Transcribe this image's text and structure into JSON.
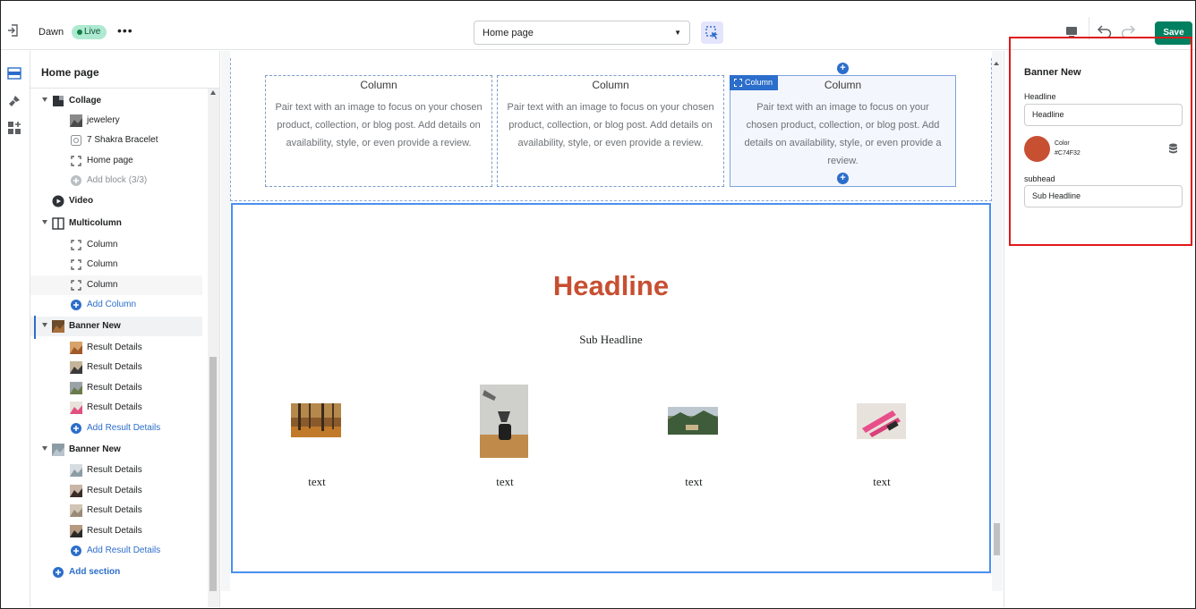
{
  "topbar": {
    "theme_name": "Dawn",
    "status_badge": "Live",
    "more_label": "•••",
    "template_select": "Home page",
    "save_label": "Save"
  },
  "sidebar": {
    "title": "Home page",
    "rows": [
      {
        "kind": "section",
        "label": "Collage",
        "icon": "collage-icon"
      },
      {
        "kind": "block",
        "label": "jewelery",
        "icon": "image-thumb"
      },
      {
        "kind": "block",
        "label": "7 Shakra Bracelet",
        "icon": "product-icon"
      },
      {
        "kind": "block",
        "label": "Home page",
        "icon": "block-frame-icon"
      },
      {
        "kind": "add-muted",
        "label": "Add block (3/3)",
        "icon": "plus-circle-icon"
      },
      {
        "kind": "section",
        "label": "Video",
        "icon": "play-icon"
      },
      {
        "kind": "section",
        "label": "Multicolumn",
        "icon": "columns-icon"
      },
      {
        "kind": "block",
        "label": "Column",
        "icon": "block-frame-icon"
      },
      {
        "kind": "block",
        "label": "Column",
        "icon": "block-frame-icon"
      },
      {
        "kind": "block",
        "label": "Column",
        "icon": "block-frame-icon"
      },
      {
        "kind": "add",
        "label": "Add Column",
        "icon": "plus-circle-icon"
      },
      {
        "kind": "section",
        "label": "Banner New",
        "icon": "image-thumb"
      },
      {
        "kind": "block",
        "label": "Result Details",
        "icon": "image-thumb"
      },
      {
        "kind": "block",
        "label": "Result Details",
        "icon": "image-thumb"
      },
      {
        "kind": "block",
        "label": "Result Details",
        "icon": "image-thumb"
      },
      {
        "kind": "block",
        "label": "Result Details",
        "icon": "image-thumb"
      },
      {
        "kind": "add",
        "label": "Add Result Details",
        "icon": "plus-circle-icon"
      },
      {
        "kind": "section",
        "label": "Banner New",
        "icon": "image-thumb"
      },
      {
        "kind": "block",
        "label": "Result Details",
        "icon": "image-thumb"
      },
      {
        "kind": "block",
        "label": "Result Details",
        "icon": "image-thumb"
      },
      {
        "kind": "block",
        "label": "Result Details",
        "icon": "image-thumb"
      },
      {
        "kind": "block",
        "label": "Result Details",
        "icon": "image-thumb"
      },
      {
        "kind": "add",
        "label": "Add Result Details",
        "icon": "plus-circle-icon"
      },
      {
        "kind": "add-section",
        "label": "Add section",
        "icon": "plus-circle-icon"
      }
    ]
  },
  "preview": {
    "columns": [
      {
        "title": "Column",
        "text": "Pair text with an image to focus on your chosen product, collection, or blog post. Add details on availability, style, or even provide a review."
      },
      {
        "title": "Column",
        "text": "Pair text with an image to focus on your chosen product, collection, or blog post. Add details on availability, style, or even provide a review."
      },
      {
        "title": "Column",
        "text": "Pair text with an image to focus on your chosen product, collection, or blog post. Add details on availability, style, or even provide a review."
      }
    ],
    "active_column_badge": "Column",
    "banner": {
      "headline": "Headline",
      "subheadline": "Sub Headline",
      "items": [
        {
          "text": "text",
          "image": "autumn-forest"
        },
        {
          "text": "text",
          "image": "pour-over-coffee"
        },
        {
          "text": "text",
          "image": "mountain-landscape"
        },
        {
          "text": "text",
          "image": "pink-pens"
        }
      ]
    }
  },
  "settings": {
    "title": "Banner New",
    "headline_label": "Headline",
    "headline_value": "Headline",
    "color_label": "Color",
    "color_value": "#C74F32",
    "subhead_label": "subhead",
    "subhead_value": "Sub Headline"
  },
  "colors": {
    "accent": "#2c6ecb",
    "save": "#008060",
    "headline": "#C74F32",
    "highlight_box": "#e0191b"
  }
}
